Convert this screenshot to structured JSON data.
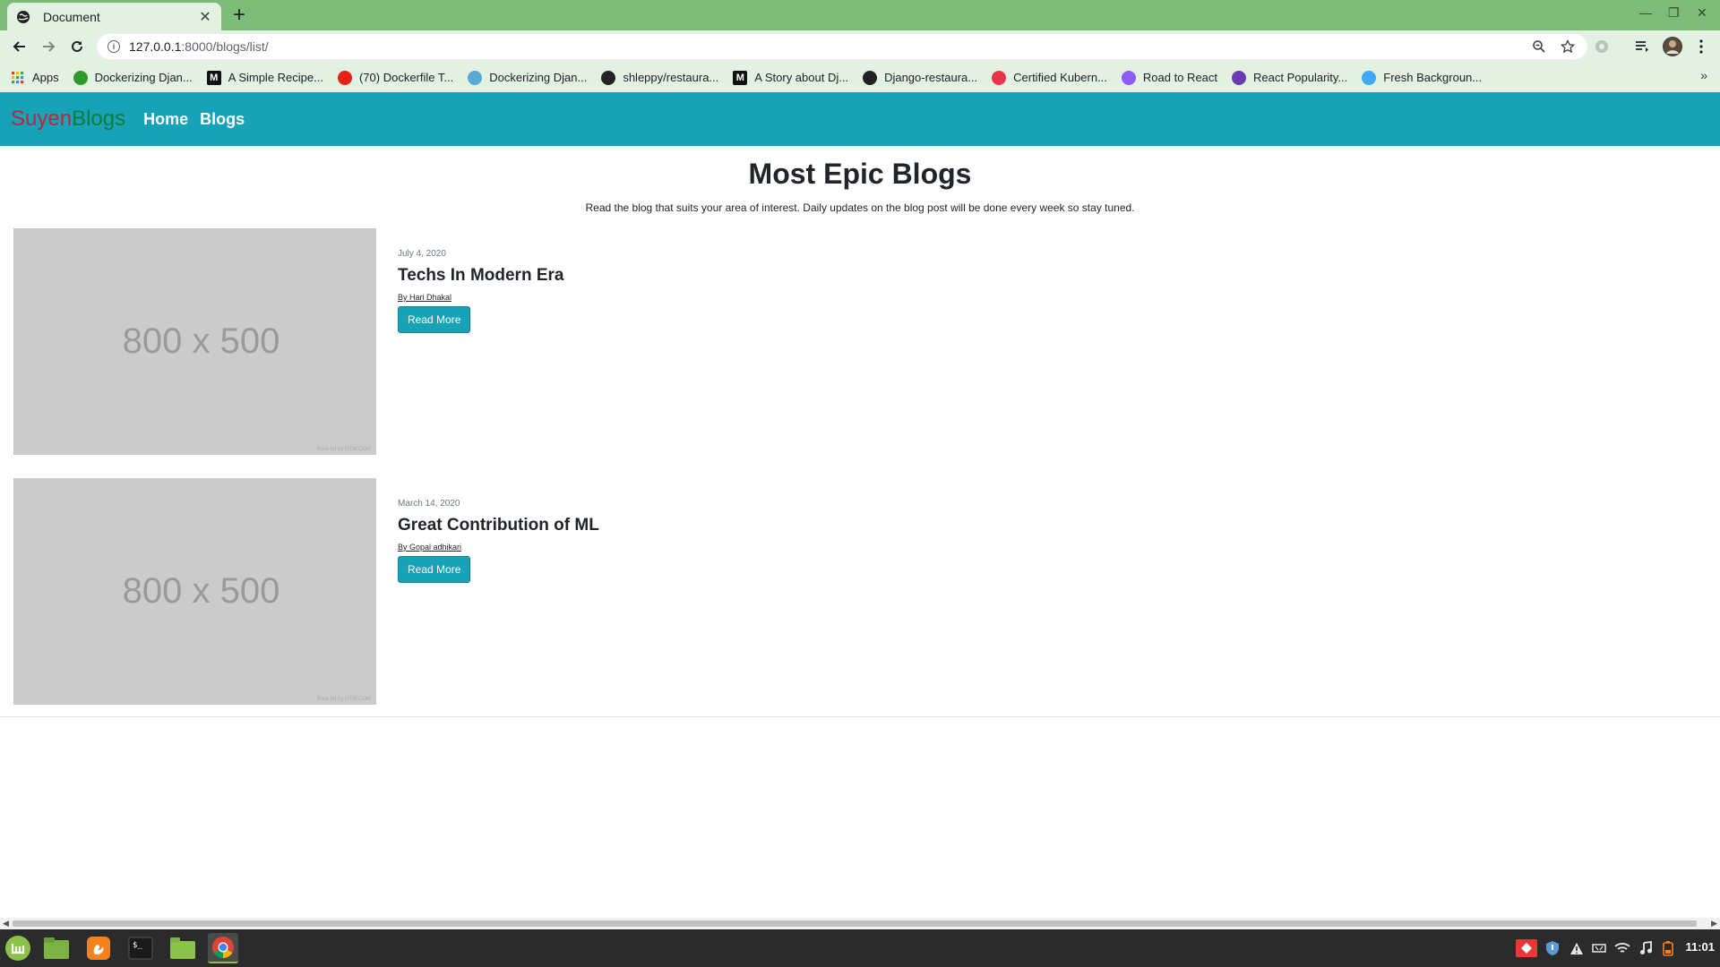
{
  "browser": {
    "tab_title": "Document",
    "tab_close": "✕",
    "new_tab": "+",
    "url_host": "127.0.0.1",
    "url_rest": ":8000/blogs/list/",
    "bookmarks": [
      {
        "label": "Apps",
        "icon": "apps-grid-icon",
        "color": "#e53935"
      },
      {
        "label": "Dockerizing Djan...",
        "icon": "django-favicon",
        "color": "#2e9a2e"
      },
      {
        "label": "A Simple Recipe...",
        "icon": "medium-favicon",
        "color": "#111111",
        "glyph": "M"
      },
      {
        "label": "(70) Dockerfile T...",
        "icon": "youtube-favicon",
        "color": "#e62117"
      },
      {
        "label": "Dockerizing Djan...",
        "icon": "cube-favicon",
        "color": "#5aa9d6"
      },
      {
        "label": "shleppy/restaura...",
        "icon": "github-favicon",
        "color": "#222222"
      },
      {
        "label": "A Story about Dj...",
        "icon": "medium-favicon",
        "color": "#111111",
        "glyph": "M"
      },
      {
        "label": "Django-restaura...",
        "icon": "github-favicon",
        "color": "#222222"
      },
      {
        "label": "Certified Kubern...",
        "icon": "record-favicon",
        "color": "#e8334a"
      },
      {
        "label": "Road to React",
        "icon": "info-favicon",
        "color": "#8b5cf6"
      },
      {
        "label": "React Popularity...",
        "icon": "react-favicon",
        "color": "#6a3ab2"
      },
      {
        "label": "Fresh Backgroun...",
        "icon": "drop-favicon",
        "color": "#3fa9f5"
      }
    ],
    "bookmarks_more": "»"
  },
  "site": {
    "brand_part1": "Suyen",
    "brand_part2": "Blogs",
    "brand_color1": "#b52a3a",
    "brand_color2": "#0f7c3a",
    "nav": [
      {
        "label": "Home"
      },
      {
        "label": "Blogs"
      }
    ],
    "accent": "#17a2b8",
    "heading": "Most Epic Blogs",
    "lead": "Read the blog that suits your area of interest. Daily updates on the blog post will be done every week so stay tuned.",
    "posts": [
      {
        "image_text": "800 x 500",
        "image_credit": "Rose let by HTW.COM",
        "date": "July 4, 2020",
        "title": "Techs In Modern Era",
        "author": "By Hari Dhakal",
        "button": "Read More"
      },
      {
        "image_text": "800 x 500",
        "image_credit": "Rose let by HTW.COM",
        "date": "March 14, 2020",
        "title": "Great Contribution of ML",
        "author": "By Gopal adhikari",
        "button": "Read More"
      }
    ]
  },
  "taskbar": {
    "clock": "11:01",
    "apps": [
      "mint-menu-icon",
      "files-icon",
      "firefox-icon",
      "terminal-icon",
      "folder-icon",
      "chrome-icon"
    ]
  }
}
